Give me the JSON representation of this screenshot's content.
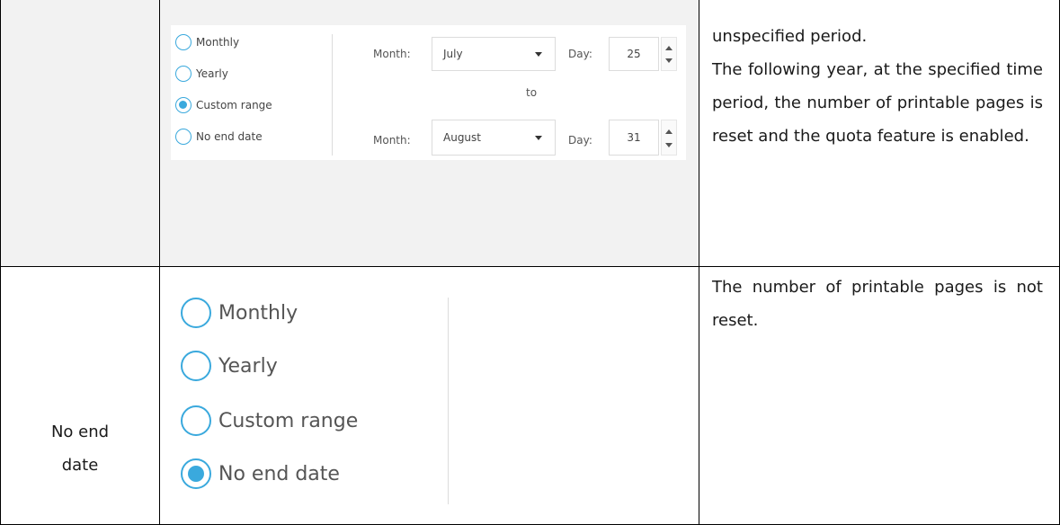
{
  "rows": [
    {
      "label": "",
      "panel": {
        "options": [
          {
            "label": "Monthly",
            "selected": false
          },
          {
            "label": "Yearly",
            "selected": false
          },
          {
            "label": "Custom range",
            "selected": true
          },
          {
            "label": "No end date",
            "selected": false
          }
        ],
        "range_start": {
          "month_label": "Month:",
          "month": "July",
          "day_label": "Day:",
          "day": "25"
        },
        "to_label": "to",
        "range_end": {
          "month_label": "Month:",
          "month": "August",
          "day_label": "Day:",
          "day": "31"
        }
      },
      "description": [
        "unspecified period.",
        "The following year, at the specified time period, the number of printable pages is reset and the quota feature is enabled."
      ]
    },
    {
      "label": "No end date",
      "panel": {
        "options": [
          {
            "label": "Monthly",
            "selected": false
          },
          {
            "label": "Yearly",
            "selected": false
          },
          {
            "label": "Custom range",
            "selected": false
          },
          {
            "label": "No end date",
            "selected": true
          }
        ]
      },
      "description": [
        "The number of printable pages is not reset."
      ]
    }
  ],
  "colors": {
    "accent": "#3aa9dd",
    "cell_grey": "#f2f2f2",
    "border": "#000000"
  }
}
